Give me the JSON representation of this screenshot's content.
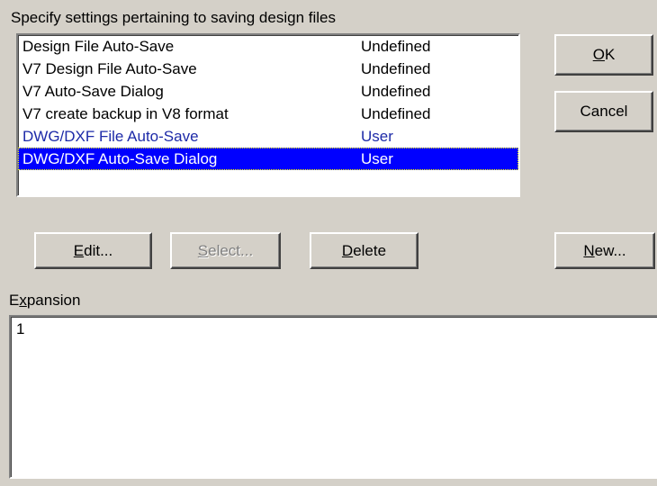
{
  "dialog": {
    "heading": "Specify settings pertaining to saving design files"
  },
  "list": {
    "items": [
      {
        "name": "Design File Auto-Save",
        "value": "Undefined"
      },
      {
        "name": "V7 Design File Auto-Save",
        "value": "Undefined"
      },
      {
        "name": "V7 Auto-Save Dialog",
        "value": "Undefined"
      },
      {
        "name": "V7 create backup in V8 format",
        "value": "Undefined"
      },
      {
        "name": "DWG/DXF File Auto-Save",
        "value": "User"
      },
      {
        "name": "DWG/DXF Auto-Save Dialog",
        "value": "User"
      }
    ],
    "selected_index": 5
  },
  "buttons": {
    "ok": {
      "pre": "",
      "accel": "O",
      "post": "K"
    },
    "cancel": {
      "pre": "Cancel",
      "accel": "",
      "post": ""
    },
    "edit": {
      "pre": "",
      "accel": "E",
      "post": "dit..."
    },
    "select": {
      "pre": "",
      "accel": "S",
      "post": "elect..."
    },
    "delete": {
      "pre": "",
      "accel": "D",
      "post": "elete"
    },
    "new": {
      "pre": "",
      "accel": "N",
      "post": "ew..."
    }
  },
  "expansion": {
    "label_pre": "E",
    "label_accel": "x",
    "label_post": "pansion",
    "value": "1"
  }
}
